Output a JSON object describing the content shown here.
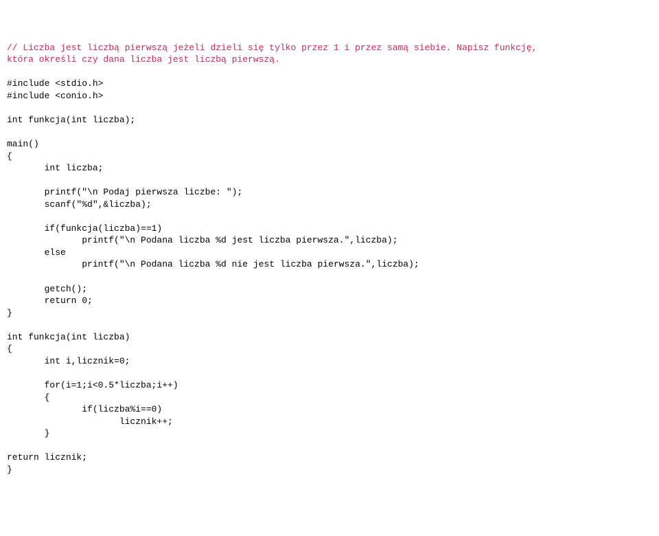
{
  "lines": [
    {
      "cls": "comment",
      "text": "// Liczba jest liczbą pierwszą jeżeli dzieli się tylko przez 1 i przez samą siebie. Napisz funkcję,"
    },
    {
      "cls": "comment",
      "text": "która określi czy dana liczba jest liczbą pierwszą."
    },
    {
      "cls": "code",
      "text": ""
    },
    {
      "cls": "code",
      "text": "#include <stdio.h>"
    },
    {
      "cls": "code",
      "text": "#include <conio.h>"
    },
    {
      "cls": "code",
      "text": ""
    },
    {
      "cls": "code",
      "text": "int funkcja(int liczba);"
    },
    {
      "cls": "code",
      "text": ""
    },
    {
      "cls": "code",
      "text": "main()"
    },
    {
      "cls": "code",
      "text": "{"
    },
    {
      "cls": "code",
      "text": "       int liczba;"
    },
    {
      "cls": "code",
      "text": ""
    },
    {
      "cls": "code",
      "text": "       printf(\"\\n Podaj pierwsza liczbe: \");"
    },
    {
      "cls": "code",
      "text": "       scanf(\"%d\",&liczba);"
    },
    {
      "cls": "code",
      "text": ""
    },
    {
      "cls": "code",
      "text": "       if(funkcja(liczba)==1)"
    },
    {
      "cls": "code",
      "text": "              printf(\"\\n Podana liczba %d jest liczba pierwsza.\",liczba);"
    },
    {
      "cls": "code",
      "text": "       else"
    },
    {
      "cls": "code",
      "text": "              printf(\"\\n Podana liczba %d nie jest liczba pierwsza.\",liczba);"
    },
    {
      "cls": "code",
      "text": ""
    },
    {
      "cls": "code",
      "text": "       getch();"
    },
    {
      "cls": "code",
      "text": "       return 0;"
    },
    {
      "cls": "code",
      "text": "}"
    },
    {
      "cls": "code",
      "text": ""
    },
    {
      "cls": "code",
      "text": "int funkcja(int liczba)"
    },
    {
      "cls": "code",
      "text": "{"
    },
    {
      "cls": "code",
      "text": "       int i,licznik=0;"
    },
    {
      "cls": "code",
      "text": ""
    },
    {
      "cls": "code",
      "text": "       for(i=1;i<0.5*liczba;i++)"
    },
    {
      "cls": "code",
      "text": "       {"
    },
    {
      "cls": "code",
      "text": "              if(liczba%i==0)"
    },
    {
      "cls": "code",
      "text": "                     licznik++;"
    },
    {
      "cls": "code",
      "text": "       }"
    },
    {
      "cls": "code",
      "text": ""
    },
    {
      "cls": "code",
      "text": "return licznik;"
    },
    {
      "cls": "code",
      "text": "}"
    }
  ]
}
